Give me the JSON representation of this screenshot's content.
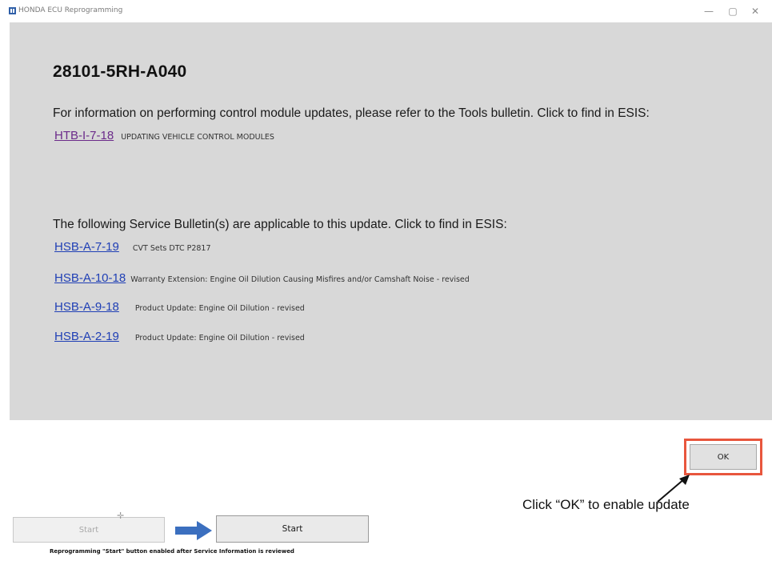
{
  "window": {
    "title": "HONDA ECU Reprogramming",
    "controls": {
      "minimize": "—",
      "maximize": "▢",
      "close": "✕"
    }
  },
  "info": {
    "part_number": "28101-5RH-A040",
    "tools_text": "For information on performing control module updates, please refer to the Tools bulletin. Click to find in ESIS:",
    "tools_bulletin": {
      "id": "HTB-I-7-18",
      "description": "UPDATING VEHICLE CONTROL MODULES"
    },
    "service_text": "The following Service Bulletin(s) are applicable to this update. Click to find in ESIS:",
    "bulletins": [
      {
        "id": "HSB-A-7-19",
        "description": "CVT Sets DTC P2817"
      },
      {
        "id": "HSB-A-10-18",
        "description": "Warranty Extension: Engine Oil Dilution Causing Misfires and/or Camshaft Noise - revised"
      },
      {
        "id": "HSB-A-9-18",
        "description": "Product Update: Engine Oil Dilution - revised"
      },
      {
        "id": "HSB-A-2-19",
        "description": "Product Update: Engine Oil Dilution - revised"
      }
    ]
  },
  "ok_button": {
    "label": "OK"
  },
  "annotation": {
    "callout": "Click “OK” to enable update",
    "highlight_color": "#e8563d"
  },
  "start": {
    "disabled_label": "Start",
    "enabled_label": "Start",
    "caption": "Reprogramming \"Start\" button enabled after Service Information is reviewed",
    "arrow_color": "#3b6fbf"
  }
}
